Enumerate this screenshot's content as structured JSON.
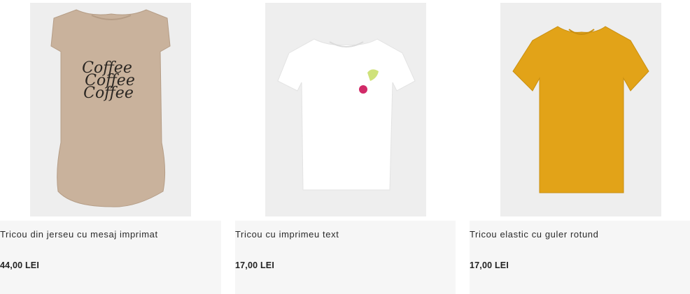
{
  "products": [
    {
      "name": "Tricou din jerseu cu mesaj imprimat",
      "price": "44,00 LEI",
      "color": "#c9b29c",
      "print": "Coffee Coffee Coffee"
    },
    {
      "name": "Tricou cu imprimeu text",
      "price": "17,00 LEI",
      "color": "#ffffff"
    },
    {
      "name": "Tricou elastic cu guler rotund",
      "price": "17,00 LEI",
      "color": "#e2a318"
    }
  ]
}
